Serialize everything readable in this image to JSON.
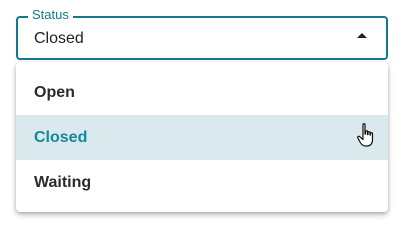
{
  "select": {
    "label": "Status",
    "value": "Closed",
    "options": [
      "Open",
      "Closed",
      "Waiting"
    ],
    "selected_index": 1
  },
  "colors": {
    "accent": "#127a8c",
    "selected_bg": "#d9e9ee",
    "selected_text": "#17889a"
  },
  "icons": {
    "caret": "caret-up-icon",
    "pointer": "hand-pointer-cursor"
  }
}
